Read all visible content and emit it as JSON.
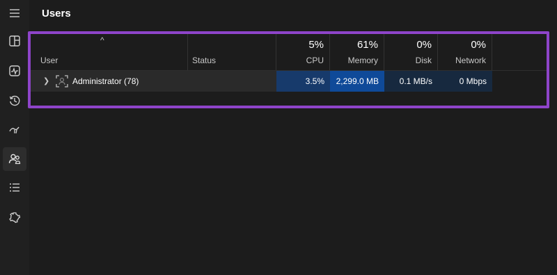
{
  "page": {
    "title": "Users"
  },
  "sidebar": {
    "items": [
      {
        "icon": "hamburger-menu-icon"
      },
      {
        "icon": "processes-icon"
      },
      {
        "icon": "performance-icon"
      },
      {
        "icon": "app-history-icon"
      },
      {
        "icon": "startup-apps-icon"
      },
      {
        "icon": "users-icon",
        "active": true
      },
      {
        "icon": "details-icon"
      },
      {
        "icon": "services-icon"
      }
    ]
  },
  "table": {
    "columns": {
      "user": {
        "label": "User"
      },
      "status": {
        "label": "Status"
      },
      "cpu": {
        "label": "CPU",
        "percent": "5%"
      },
      "memory": {
        "label": "Memory",
        "percent": "61%"
      },
      "disk": {
        "label": "Disk",
        "percent": "0%"
      },
      "network": {
        "label": "Network",
        "percent": "0%"
      }
    },
    "sort_indicator": "^",
    "rows": [
      {
        "name": "Administrator (78)",
        "status": "",
        "cpu": "3.5%",
        "memory": "2,299.0 MB",
        "disk": "0.1 MB/s",
        "network": "0 Mbps"
      }
    ]
  },
  "colors": {
    "accent_frame": "#8e44c9",
    "heat_cpu": "#173a6b",
    "heat_memory": "#0f4a99",
    "heat_disk": "#17293f",
    "heat_network": "#17293f"
  }
}
